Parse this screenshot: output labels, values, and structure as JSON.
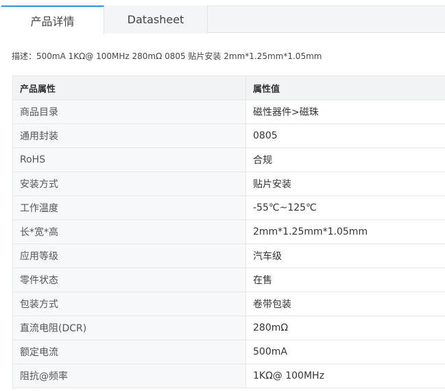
{
  "tabs": [
    {
      "label": "产品详情",
      "active": true
    },
    {
      "label": "Datasheet",
      "active": false
    }
  ],
  "description": "描述：500mA 1KΩ@ 100MHz 280mΩ 0805 贴片安装 2mm*1.25mm*1.05mm",
  "table": {
    "headers": {
      "name": "产品属性",
      "value": "属性值"
    },
    "rows": [
      {
        "name": "商品目录",
        "value": "磁性器件>磁珠"
      },
      {
        "name": "通用封装",
        "value": "0805"
      },
      {
        "name": "RoHS",
        "value": "合规"
      },
      {
        "name": "安装方式",
        "value": "贴片安装"
      },
      {
        "name": "工作温度",
        "value": "-55℃~125℃"
      },
      {
        "name": "长*宽*高",
        "value": "2mm*1.25mm*1.05mm"
      },
      {
        "name": "应用等级",
        "value": "汽车级"
      },
      {
        "name": "零件状态",
        "value": "在售"
      },
      {
        "name": "包装方式",
        "value": "卷带包装"
      },
      {
        "name": "直流电阻(DCR)",
        "value": "280mΩ"
      },
      {
        "name": "额定电流",
        "value": "500mA"
      },
      {
        "name": "阻抗@频率",
        "value": "1KΩ@ 100MHz"
      }
    ]
  },
  "colors": {
    "accent": "#199fe9",
    "tab_bar_bg": "#f4f5f7",
    "header_bg": "#f2f3f5",
    "name_cell_bg": "#f7f8fa",
    "border": "#e6e6e6"
  }
}
